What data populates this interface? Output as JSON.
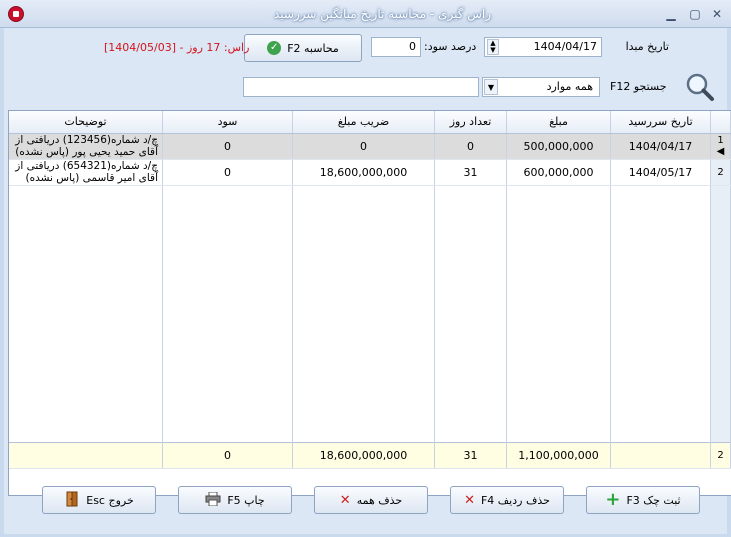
{
  "window": {
    "title": "راس گیری - محاسبه تاریخ میانگین سررسید"
  },
  "form": {
    "start_date_label": "تاریخ مبدا",
    "start_date_value": "1404/04/17",
    "interest_label": "درصد سود:",
    "interest_value": "0",
    "calc_button_label": "محاسبه F2",
    "result_text": "راس: 17 روز - [1404/05/03]",
    "search_label": "جستجو F12",
    "filter_value": "همه موارد",
    "search_value": ""
  },
  "table": {
    "headers": [
      "تاریخ سررسید",
      "مبلغ",
      "تعداد روز",
      "ضریب مبلغ",
      "سود",
      "توضیحات"
    ],
    "rows": [
      {
        "row_num": "1",
        "due_date": "1404/04/17",
        "amount": "500,000,000",
        "days": "0",
        "coef": "0",
        "profit": "0",
        "desc": "چ/د شماره(123456) دریافتی از آقای حمید یحیی پور (پاس نشده)"
      },
      {
        "row_num": "2",
        "due_date": "1404/05/17",
        "amount": "600,000,000",
        "days": "31",
        "coef": "18,600,000,000",
        "profit": "0",
        "desc": "چ/د شماره(654321) دریافتی از آقای امیر قاسمی (پاس نشده)"
      }
    ],
    "totals": {
      "row_count": "2",
      "amount": "1,100,000,000",
      "days": "31",
      "coef": "18,600,000,000",
      "profit": "0"
    }
  },
  "buttons": {
    "register": "ثبت چک F3",
    "delete_row": "حذف ردیف F4",
    "delete_all": "حذف همه",
    "print": "چاپ F5",
    "exit": "خروج Esc"
  }
}
